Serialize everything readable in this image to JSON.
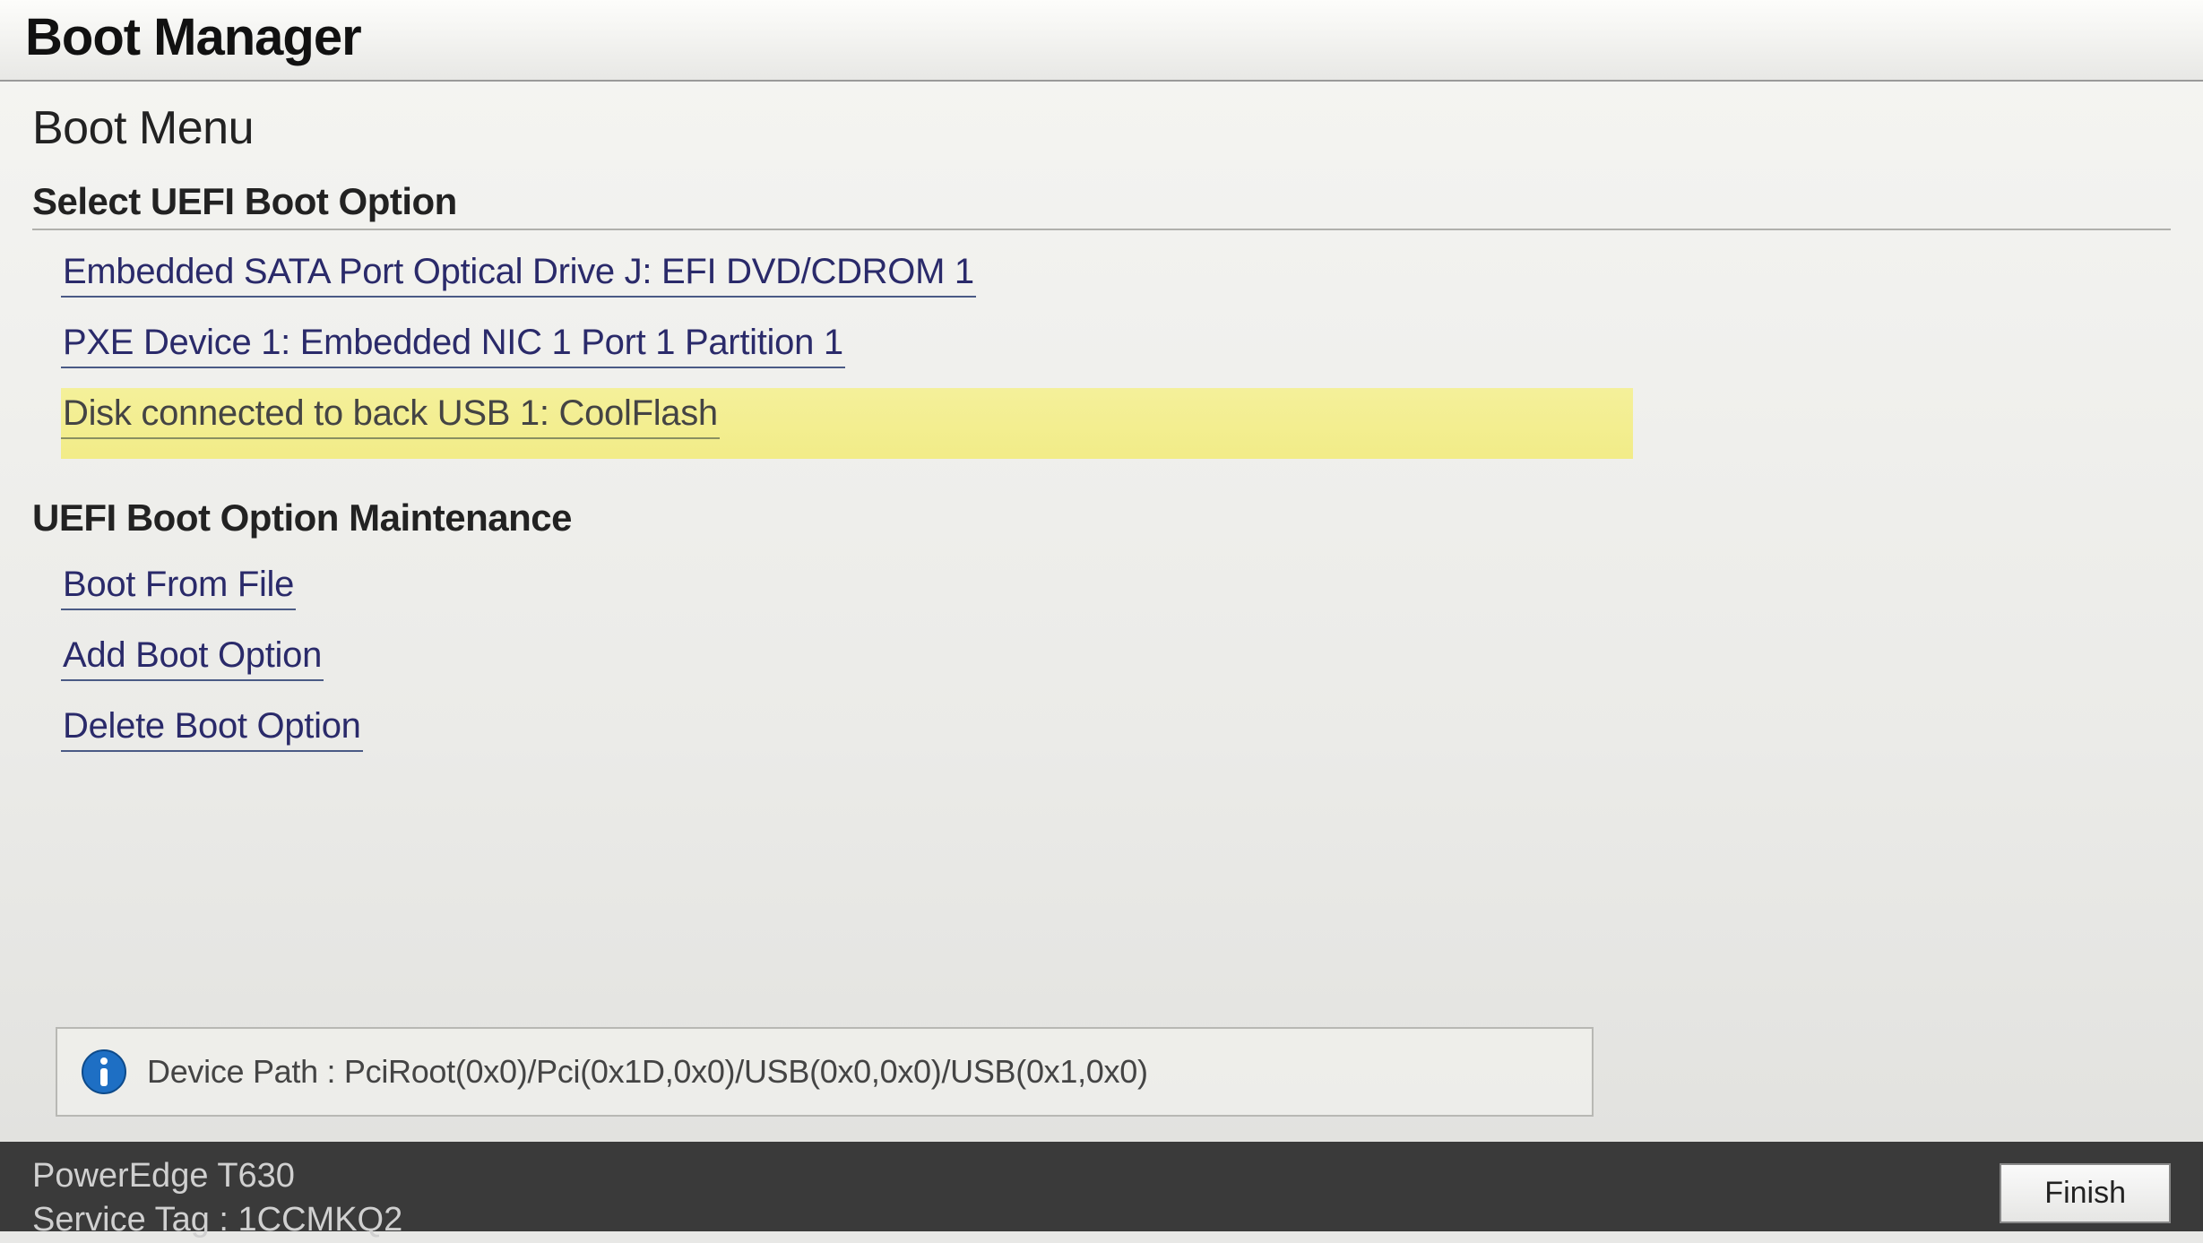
{
  "header": {
    "title": "Boot Manager"
  },
  "subtitle": "Boot Menu",
  "section_select": {
    "heading": "Select UEFI Boot Option",
    "options": [
      {
        "label": "Embedded SATA Port Optical Drive J: EFI DVD/CDROM 1",
        "highlighted": false
      },
      {
        "label": "PXE Device 1: Embedded NIC 1 Port 1 Partition 1",
        "highlighted": false
      },
      {
        "label": "Disk connected to back USB 1: CoolFlash",
        "highlighted": true
      }
    ]
  },
  "section_maintenance": {
    "heading": "UEFI Boot Option Maintenance",
    "options": [
      {
        "label": "Boot From File"
      },
      {
        "label": "Add Boot Option"
      },
      {
        "label": "Delete Boot Option"
      }
    ]
  },
  "info": {
    "text": "Device Path : PciRoot(0x0)/Pci(0x1D,0x0)/USB(0x0,0x0)/USB(0x1,0x0)"
  },
  "footer": {
    "model": "PowerEdge T630",
    "service_tag_label": "Service Tag :",
    "service_tag_value": "1CCMKQ2",
    "finish_label": "Finish"
  }
}
